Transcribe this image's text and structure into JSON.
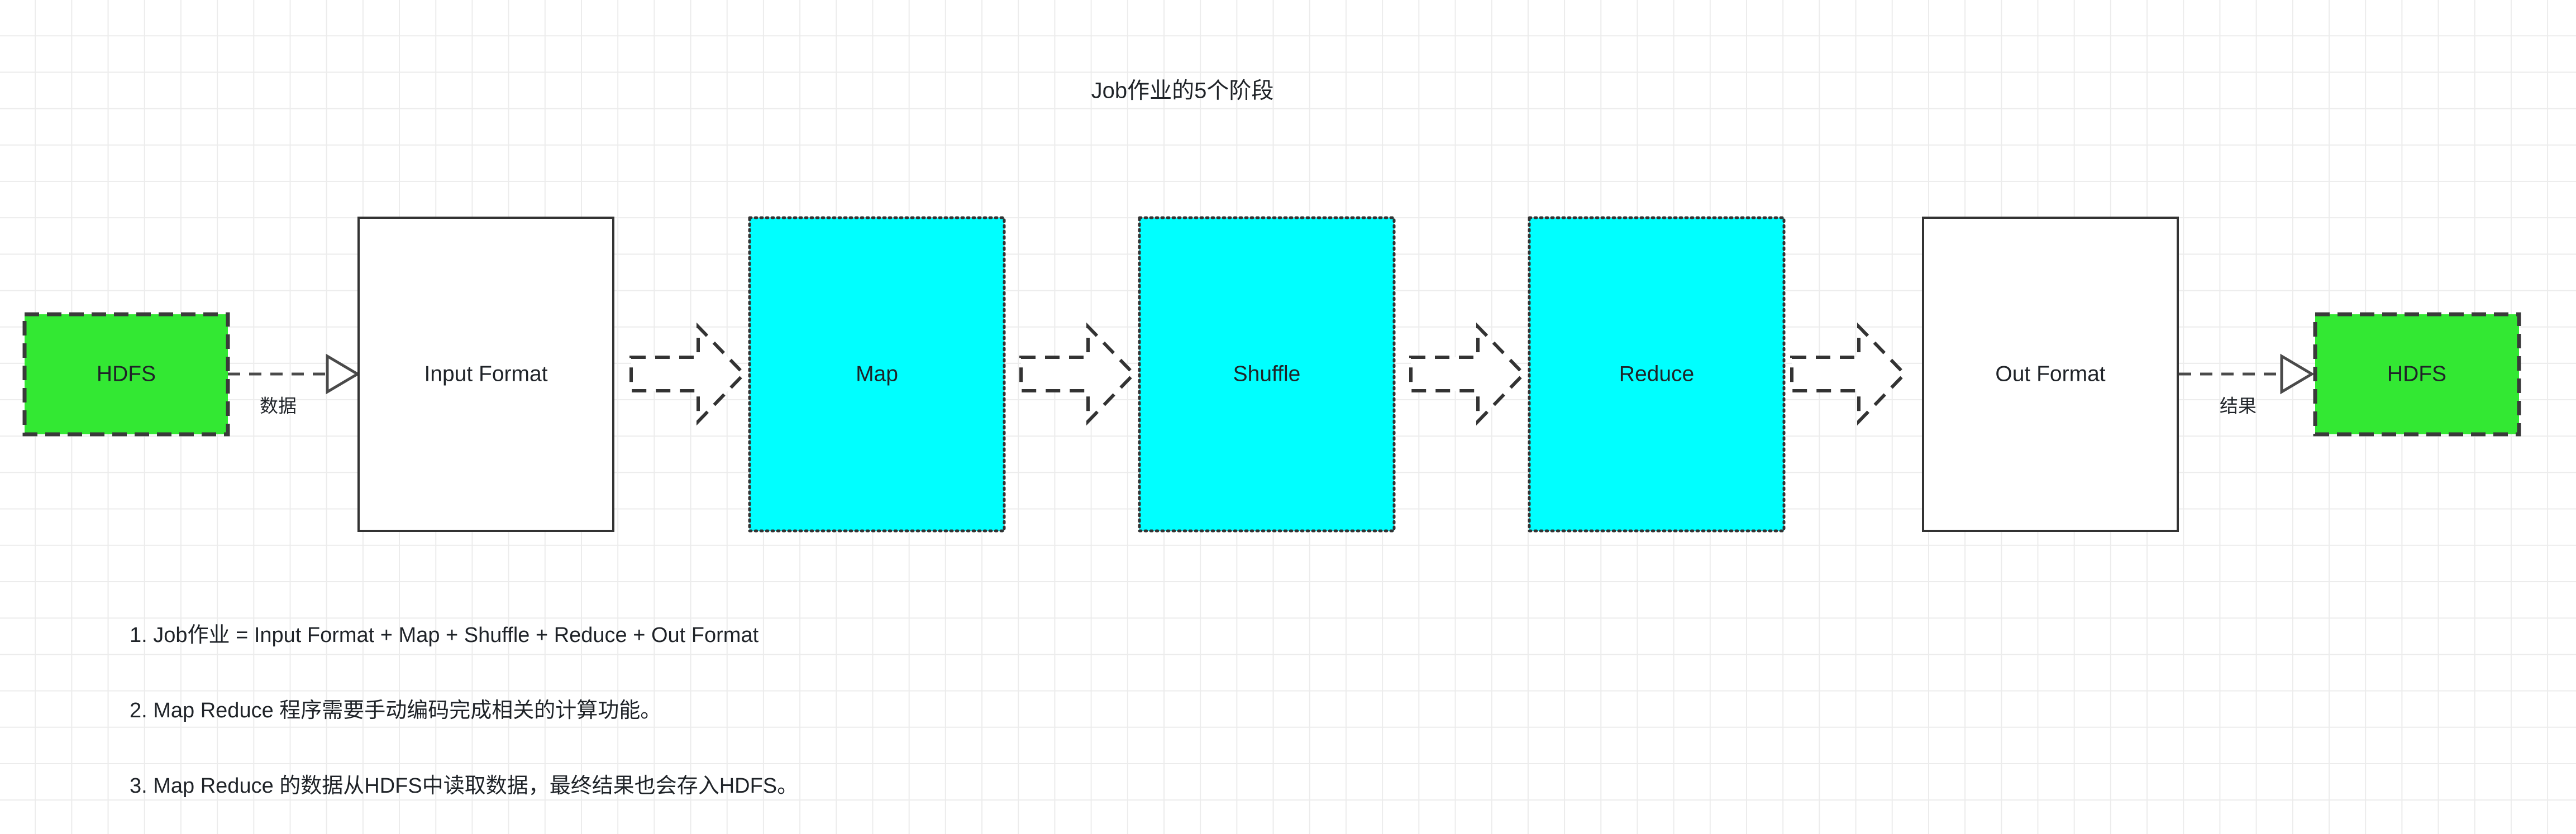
{
  "title": "Job作业的5个阶段",
  "diagram": {
    "stages": [
      {
        "id": "hdfs-in",
        "label": "HDFS",
        "kind": "store"
      },
      {
        "id": "input-format",
        "label": "Input Format",
        "kind": "plain"
      },
      {
        "id": "map",
        "label": "Map",
        "kind": "process"
      },
      {
        "id": "shuffle",
        "label": "Shuffle",
        "kind": "process"
      },
      {
        "id": "reduce",
        "label": "Reduce",
        "kind": "process"
      },
      {
        "id": "out-format",
        "label": "Out Format",
        "kind": "plain"
      },
      {
        "id": "hdfs-out",
        "label": "HDFS",
        "kind": "store"
      }
    ],
    "edges": [
      {
        "id": "edge-data",
        "label": "数据",
        "style": "thin-dashed-arrow"
      },
      {
        "id": "edge-1",
        "label": "",
        "style": "dashed-block-arrow"
      },
      {
        "id": "edge-2",
        "label": "",
        "style": "dashed-block-arrow"
      },
      {
        "id": "edge-3",
        "label": "",
        "style": "dashed-block-arrow"
      },
      {
        "id": "edge-4",
        "label": "",
        "style": "dashed-block-arrow"
      },
      {
        "id": "edge-result",
        "label": "结果",
        "style": "thin-dashed-arrow"
      }
    ],
    "colors": {
      "store_fill": "#33e833",
      "process_fill": "#00ffff",
      "plain_fill": "#ffffff",
      "stroke": "#333333",
      "text": "#1f2328",
      "grid_line": "#ececec",
      "background": "#ffffff"
    }
  },
  "notes": [
    "1. Job作业 = Input Format + Map + Shuffle + Reduce + Out Format",
    "2. Map Reduce 程序需要手动编码完成相关的计算功能。",
    "3. Map Reduce 的数据从HDFS中读取数据，最终结果也会存入HDFS。"
  ]
}
